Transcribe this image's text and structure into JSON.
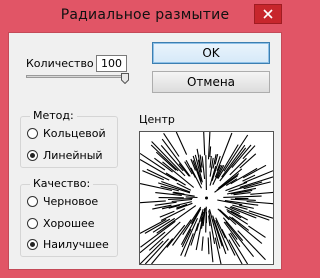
{
  "window": {
    "title": "Радиальное размытие",
    "close_label": "close-icon"
  },
  "amount": {
    "label": "Количество",
    "value": "100",
    "slider_min": 1,
    "slider_max": 100,
    "slider_value": 100
  },
  "buttons": {
    "ok": "OK",
    "cancel": "Отмена"
  },
  "method": {
    "legend": "Метод:",
    "options": [
      "Кольцевой",
      "Линейный"
    ],
    "selected": 1
  },
  "quality": {
    "legend": "Качество:",
    "options": [
      "Черновое",
      "Хорошее",
      "Наилучшее"
    ],
    "selected": 2
  },
  "center": {
    "label": "Центр",
    "point": [
      0.5,
      0.5
    ]
  },
  "colors": {
    "titlebar": "#e15566",
    "close_button": "#c7262c",
    "dialog_bg": "#f0f0f0",
    "default_button_border": "#3c7fb1"
  }
}
